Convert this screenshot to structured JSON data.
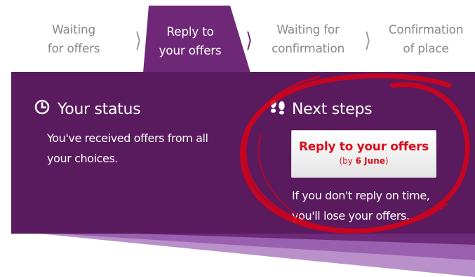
{
  "steps": [
    {
      "line1": "Waiting",
      "line2": "for offers"
    },
    {
      "line1": "Reply to",
      "line2": "your offers"
    },
    {
      "line1": "Waiting for",
      "line2": "confirmation"
    },
    {
      "line1": "Confirmation",
      "line2": "of place"
    }
  ],
  "active_step_index": 1,
  "status": {
    "title": "Your status",
    "line1": "You've received offers from all",
    "line2": "your choices."
  },
  "next_steps": {
    "title": "Next steps",
    "button_label": "Reply to your offers",
    "deadline_prefix": "(by ",
    "deadline_date": "6 June",
    "deadline_suffix": ")",
    "warning_line1": "If you don't reply on time,",
    "warning_line2": "you'll lose your offers."
  },
  "colors": {
    "panel": "#5a1a5e",
    "active_tab": "#6f2877",
    "button_text": "#d8101e",
    "annotation_circle": "#d0021b"
  },
  "icons": {
    "status": "clock-icon",
    "next_steps": "footprints-icon"
  }
}
